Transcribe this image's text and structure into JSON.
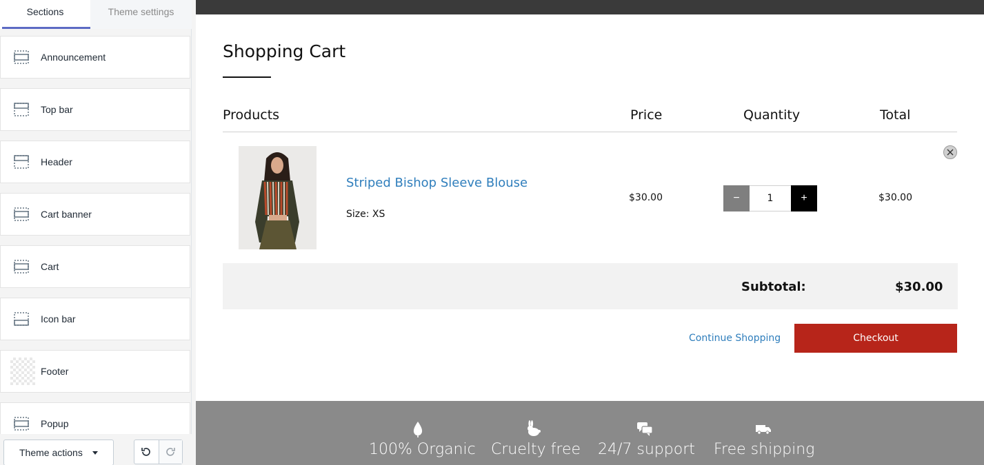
{
  "sidebar": {
    "tabs": [
      {
        "label": "Sections"
      },
      {
        "label": "Theme settings"
      }
    ],
    "sections": [
      {
        "label": "Announcement",
        "icon": "section-layout-icon"
      },
      {
        "label": "Top bar",
        "icon": "section-layout-icon"
      },
      {
        "label": "Header",
        "icon": "section-layout-icon"
      },
      {
        "label": "Cart banner",
        "icon": "section-layout-icon"
      },
      {
        "label": "Cart",
        "icon": "section-layout-icon"
      },
      {
        "label": "Icon bar",
        "icon": "section-layout-icon"
      },
      {
        "label": "Footer",
        "icon": "checker-thumbnail"
      },
      {
        "label": "Popup",
        "icon": "section-layout-icon"
      }
    ],
    "theme_actions_label": "Theme actions"
  },
  "cart": {
    "title": "Shopping Cart",
    "columns": {
      "products": "Products",
      "price": "Price",
      "quantity": "Quantity",
      "total": "Total"
    },
    "item": {
      "name": "Striped Bishop Sleeve Blouse",
      "size": "Size: XS",
      "price": "$30.00",
      "quantity": "1",
      "total": "$30.00"
    },
    "subtotal_label": "Subtotal:",
    "subtotal_value": "$30.00",
    "continue_label": "Continue Shopping",
    "checkout_label": "Checkout"
  },
  "icon_bar": [
    {
      "label": "100% Organic",
      "icon": "leaf-icon"
    },
    {
      "label": "Cruelty free",
      "icon": "rabbit-icon"
    },
    {
      "label": "24/7 support",
      "icon": "chat-icon"
    },
    {
      "label": "Free shipping",
      "icon": "truck-icon"
    }
  ],
  "colors": {
    "accent": "#5c6ac4",
    "link": "#2f7ebc",
    "checkout": "#b7251a",
    "icon_bar_bg": "#8a8a8a"
  }
}
